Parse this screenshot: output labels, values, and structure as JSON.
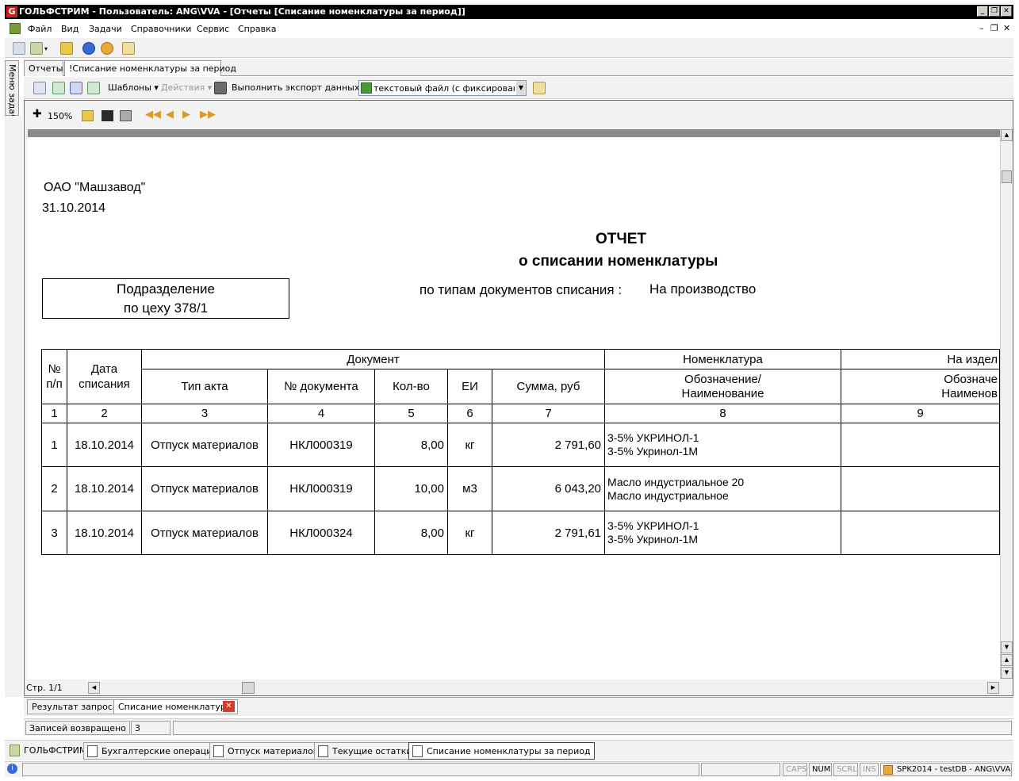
{
  "window": {
    "app_icon_letter": "G",
    "title": "ГОЛЬФСТРИМ - Пользователь: ANG\\VVA - [Отчеты  [Списание номенклатуры за период]]",
    "min": "_",
    "max": "❐",
    "close": "✕"
  },
  "menu": {
    "items": [
      "Файл",
      "Вид",
      "Задачи",
      "Справочники",
      "Сервис",
      "Справка"
    ],
    "mdi_min": "–",
    "mdi_max": "❐",
    "mdi_close": "✕"
  },
  "side_tab": {
    "label": "Меню задач"
  },
  "doc_tabs": [
    "Отчеты",
    "!Списание номенклатуры за период"
  ],
  "report_toolbar": {
    "templates": "Шаблоны ▾",
    "actions": "Действия ▾",
    "export_label": "Выполнить экспорт данных в:",
    "export_value": "текстовый файл (с фиксированным"
  },
  "viewer": {
    "zoom": "150%",
    "page": "Стр. 1/1"
  },
  "report": {
    "company": "ОАО \"Машзавод\"",
    "date": "31.10.2014",
    "title_line1": "ОТЧЕТ",
    "title_line2": "о списании номенклатуры",
    "subtitle_label": "по типам документов списания :",
    "subtitle_value": "На производство",
    "dept_line1": "Подразделение",
    "dept_line2": "по цеху 378/1",
    "headers": {
      "num": "№ п/п",
      "date": "Дата списания",
      "document": "Документ",
      "act_type": "Тип акта",
      "doc_no": "№ документа",
      "qty": "Кол-во",
      "unit": "ЕИ",
      "sum": "Сумма, руб",
      "nomenclature": "Номенклатура",
      "designation": "Обозначение/ Наименование",
      "product": "На издел",
      "product_designation": "Обозначе Наименов"
    },
    "col_numbers": [
      "1",
      "2",
      "3",
      "4",
      "5",
      "6",
      "7",
      "8",
      "9"
    ],
    "rows": [
      {
        "n": "1",
        "date": "18.10.2014",
        "type": "Отпуск материалов",
        "doc": "НКЛ000319",
        "qty": "8,00",
        "unit": "кг",
        "sum": "2 791,60",
        "nom1": "3-5% УКРИНОЛ-1",
        "nom2": "3-5% Укринол-1М"
      },
      {
        "n": "2",
        "date": "18.10.2014",
        "type": "Отпуск материалов",
        "doc": "НКЛ000319",
        "qty": "10,00",
        "unit": "м3",
        "sum": "6 043,20",
        "nom1": "Масло индустриальное 20",
        "nom2": "Масло индустриальное"
      },
      {
        "n": "3",
        "date": "18.10.2014",
        "type": "Отпуск материалов",
        "doc": "НКЛ000324",
        "qty": "8,00",
        "unit": "кг",
        "sum": "2 791,61",
        "nom1": "3-5% УКРИНОЛ-1",
        "nom2": "3-5% Укринол-1М"
      }
    ]
  },
  "bottom_tabs": [
    "Результат запроса",
    "Списание номенклатуры"
  ],
  "records": {
    "label": "Записей возвращено",
    "count": "3"
  },
  "taskbar": [
    "ГОЛЬФСТРИМ",
    "Бухгалтерские операции",
    "Отпуск материалов",
    "Текущие остатки",
    "Списание номенклатуры за период"
  ],
  "status": {
    "caps": "CAPS",
    "num": "NUM",
    "scrl": "SCRL",
    "ins": "INS",
    "db": "SPK2014 - testDB - ANG\\VVA"
  },
  "colors": {
    "title_bg": "#000000",
    "app_icon": "#c8201a",
    "close_red": "#d83a2a",
    "frame": "#f2f2f2"
  }
}
